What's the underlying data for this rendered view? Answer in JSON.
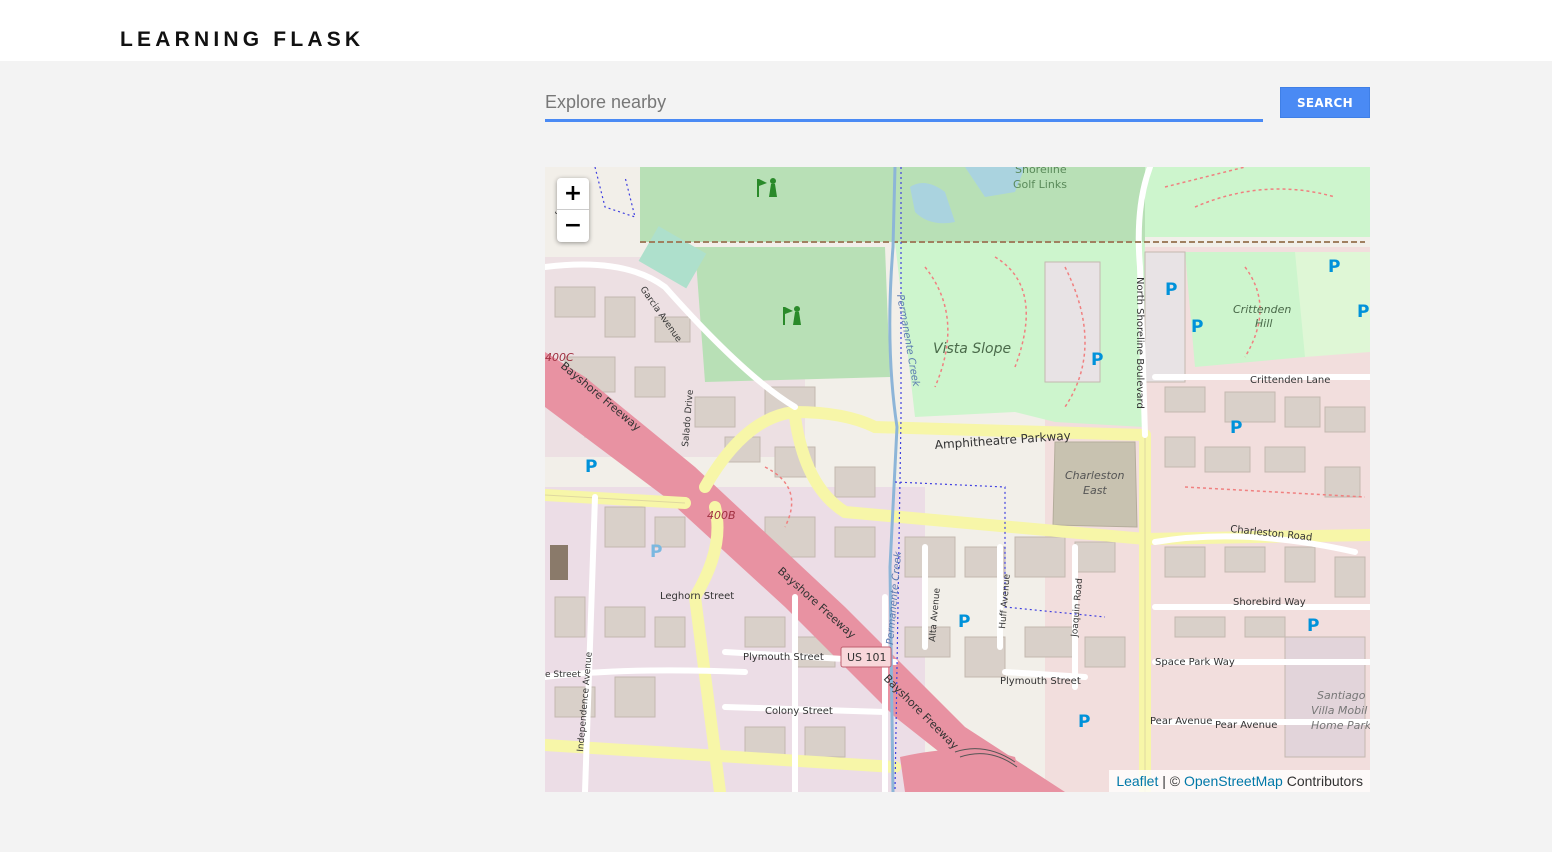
{
  "header": {
    "brand": "LEARNING FLASK"
  },
  "search": {
    "placeholder": "Explore nearby",
    "value": "",
    "button_label": "SEARCH"
  },
  "map": {
    "zoom_in_label": "+",
    "zoom_out_label": "−",
    "attribution": {
      "leaflet_link": "Leaflet",
      "separator": " | © ",
      "osm_link": "OpenStreetMap",
      "suffix": " Contributors"
    },
    "labels": {
      "shoreline_line1": "Shoreline",
      "shoreline_line2": "Golf Links",
      "vista_slope": "Vista Slope",
      "crittenden_hill_line1": "Crittenden",
      "crittenden_hill_line2": "Hill",
      "crittenden_lane": "Crittenden Lane",
      "north_shoreline_blvd": "North Shoreline Boulevard",
      "amphitheatre_parkway": "Amphitheatre Parkway",
      "charleston_east_line1": "Charleston",
      "charleston_east_line2": "East",
      "charleston_road": "Charleston Road",
      "shorebird_way": "Shorebird Way",
      "space_park_way": "Space Park Way",
      "pear_avenue_1": "Pear Avenue",
      "pear_avenue_2": "Pear Avenue",
      "santiago_line1": "Santiago",
      "santiago_line2": "Villa Mobil",
      "santiago_line3": "Home Park",
      "bayshore_freeway_1": "Bayshore Freeway",
      "bayshore_freeway_2": "Bayshore Freeway",
      "bayshore_freeway_3": "Bayshore Freeway",
      "exit_400c": "400C",
      "exit_400b": "400B",
      "us101": "US 101",
      "garcia_avenue": "Garcia Avenue",
      "salado_drive": "Salado Drive",
      "permanente_creek_1": "Permanente Creek",
      "permanente_creek_2": "Permanente Creek",
      "leghorn_street": "Leghorn Street",
      "plymouth_street_1": "Plymouth Street",
      "plymouth_street_2": "Plymouth Street",
      "colony_street": "Colony Street",
      "independence_avenue": "Independence Avenue",
      "alta_avenue": "Alta Avenue",
      "huff_avenue": "Huff Avenue",
      "joaquin_road": "Joaquin Road",
      "street_fragment": "e Street",
      "way_fragment": "Way",
      "parking": "P"
    }
  }
}
